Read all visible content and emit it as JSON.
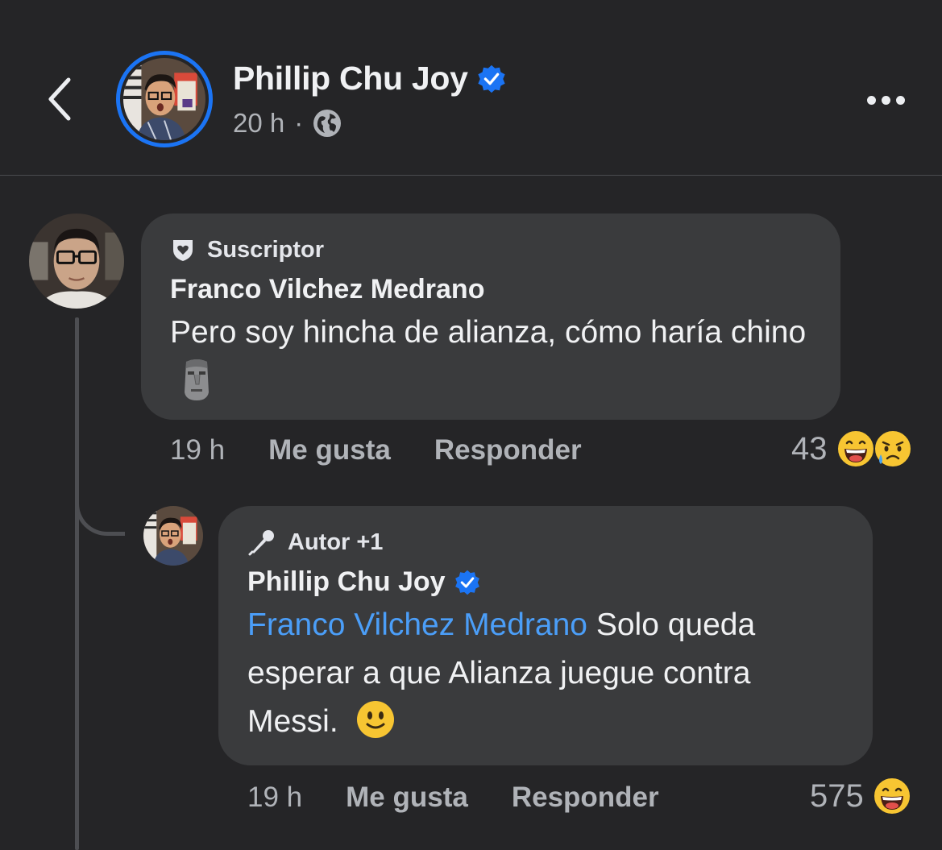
{
  "header": {
    "name": "Phillip Chu Joy",
    "time": "20 h",
    "separator": "·",
    "audience_icon": "globe-icon",
    "verified_icon": "verified-badge-icon"
  },
  "comments": [
    {
      "badge": "Suscriptor",
      "badge_icon": "shield-heart-icon",
      "author": "Franco Vilchez Medrano",
      "text": "Pero soy hincha de alianza, cómo haría chino",
      "inline_emoji": "moai",
      "time": "19 h",
      "like_label": "Me gusta",
      "reply_label": "Responder",
      "reaction_count": "43",
      "reactions": [
        "laughing",
        "crying"
      ]
    },
    {
      "badge": "Autor +1",
      "badge_icon": "microphone-icon",
      "author": "Phillip Chu Joy",
      "mention": "Franco Vilchez Medrano",
      "text": " Solo queda esperar a que Alianza juegue contra Messi.",
      "inline_emoji": "slightly-smiling",
      "time": "19 h",
      "like_label": "Me gusta",
      "reply_label": "Responder",
      "reaction_count": "575",
      "reactions": [
        "laughing"
      ]
    }
  ],
  "colors": {
    "background": "#252527",
    "bubble": "#3a3b3d",
    "accent": "#1b74f4",
    "mention": "#4b9ef8",
    "muted": "#b0b3b8"
  }
}
